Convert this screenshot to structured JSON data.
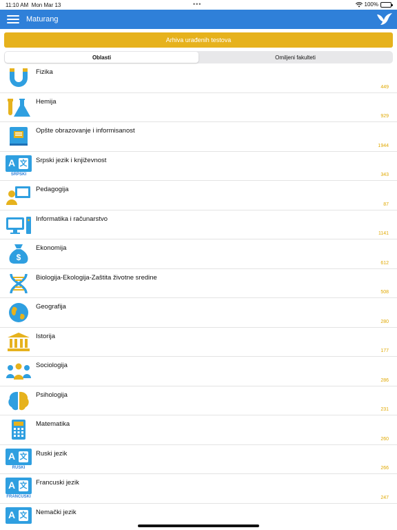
{
  "status": {
    "time": "11:10 AM",
    "date": "Mon Mar 13",
    "battery": "100%"
  },
  "nav": {
    "title": "Maturang"
  },
  "archive_button": "Arhiva urađenih testova",
  "segments": [
    {
      "label": "Oblasti",
      "active": true
    },
    {
      "label": "Omiljeni fakulteti",
      "active": false
    }
  ],
  "colors": {
    "primary": "#2f80d9",
    "accent": "#e6b21d",
    "icon_blue": "#2f9fe0",
    "count": "#e0a800"
  },
  "subjects": [
    {
      "name": "Fizika",
      "count": "449",
      "icon": "magnet-icon"
    },
    {
      "name": "Hemija",
      "count": "929",
      "icon": "flask-icon"
    },
    {
      "name": "Opšte obrazovanje i informisanost",
      "count": "1944",
      "icon": "book-icon"
    },
    {
      "name": "Srpski jezik i književnost",
      "count": "343",
      "icon": "language-icon",
      "badge": "SRPSKI"
    },
    {
      "name": "Pedagogija",
      "count": "87",
      "icon": "teacher-icon"
    },
    {
      "name": "Informatika i računarstvo",
      "count": "1141",
      "icon": "computer-icon"
    },
    {
      "name": "Ekonomija",
      "count": "612",
      "icon": "money-bag-icon"
    },
    {
      "name": "Biologija-Ekologija-Zaštita životne sredine",
      "count": "508",
      "icon": "dna-icon"
    },
    {
      "name": "Geografija",
      "count": "280",
      "icon": "globe-icon"
    },
    {
      "name": "Istorija",
      "count": "177",
      "icon": "museum-icon"
    },
    {
      "name": "Sociologija",
      "count": "286",
      "icon": "people-icon"
    },
    {
      "name": "Psihologija",
      "count": "231",
      "icon": "brain-icon"
    },
    {
      "name": "Matematika",
      "count": "260",
      "icon": "calculator-icon"
    },
    {
      "name": "Ruski jezik",
      "count": "266",
      "icon": "language-icon",
      "badge": "RUSKI"
    },
    {
      "name": "Francuski jezik",
      "count": "247",
      "icon": "language-icon",
      "badge": "FRANCUSKI"
    },
    {
      "name": "Nemački jezik",
      "count": "",
      "icon": "language-icon",
      "badge": ""
    }
  ]
}
